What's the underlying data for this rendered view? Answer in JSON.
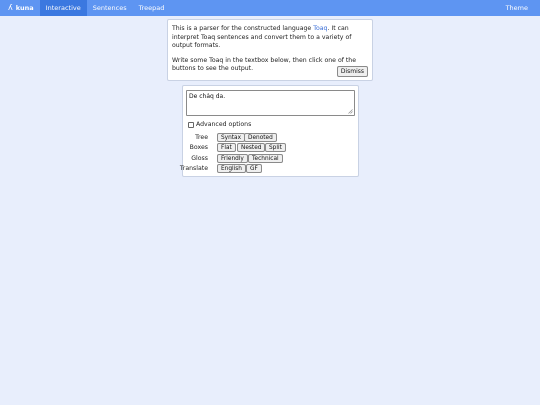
{
  "navbar": {
    "brand": "kuna",
    "brand_icon": "lambda-icon",
    "links": [
      "Interactive",
      "Sentences",
      "Treepad"
    ],
    "active": "Interactive",
    "theme_label": "Theme",
    "color": "#5e95f2",
    "active_color": "#3b78e0"
  },
  "intro": {
    "text_before_link": "This is a parser for the constructed language ",
    "link": "Toaq",
    "text_after_link": ". It can interpret Toaq sentences and convert them to a variety of output formats.",
    "instructions": "Write some Toaq in the textbox below, then click one of the buttons to see the output.",
    "dismiss_label": "Dismiss"
  },
  "editor": {
    "value": "De chảq da."
  },
  "advanced": {
    "label": "Advanced options",
    "checked": false
  },
  "outputs": [
    {
      "label": "Tree",
      "buttons": [
        "Syntax",
        "Denoted"
      ]
    },
    {
      "label": "Boxes",
      "buttons": [
        "Flat",
        "Nested",
        "Split"
      ]
    },
    {
      "label": "Gloss",
      "buttons": [
        "Friendly",
        "Technical"
      ]
    },
    {
      "label": "Translate",
      "buttons": [
        "English",
        "GF"
      ]
    }
  ],
  "colors": {
    "background": "#e8eefc",
    "link": "#3b6fd8"
  }
}
